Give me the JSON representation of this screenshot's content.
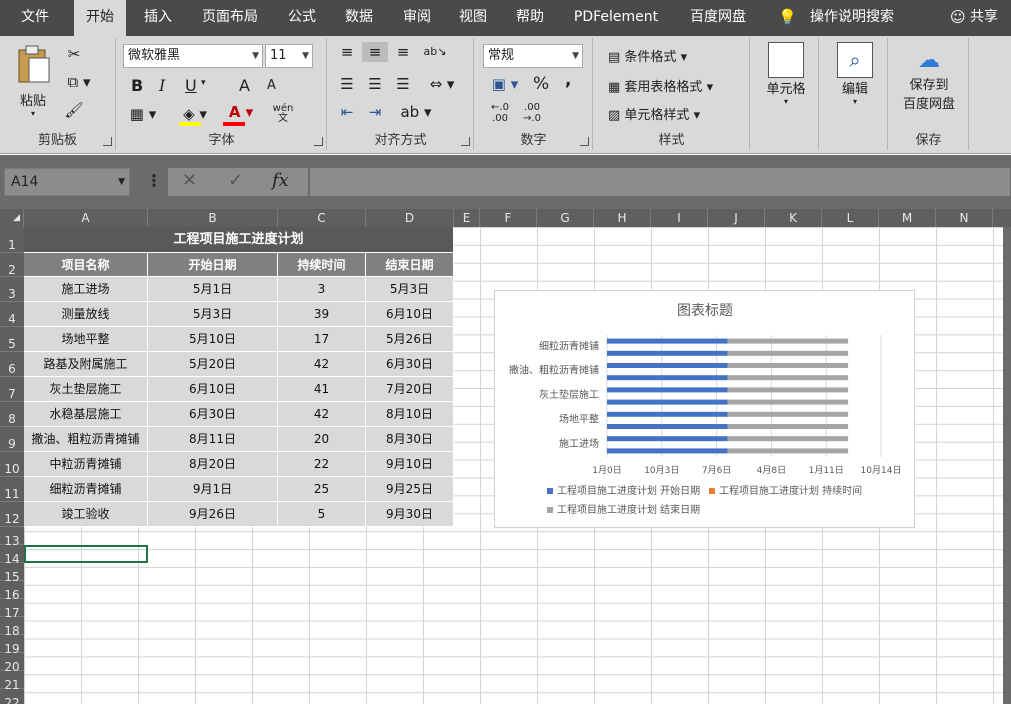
{
  "tabs": [
    "文件",
    "开始",
    "插入",
    "页面布局",
    "公式",
    "数据",
    "审阅",
    "视图",
    "帮助",
    "PDFelement",
    "百度网盘"
  ],
  "active_tab": "开始",
  "tell_me": "操作说明搜索",
  "share": "共享",
  "ribbon": {
    "clipboard": {
      "label": "剪贴板",
      "paste": "粘贴"
    },
    "font": {
      "label": "字体",
      "name": "微软雅黑",
      "size": "11",
      "bold": "B",
      "italic": "I",
      "underline": "U",
      "grow": "A",
      "shrink": "A",
      "wen": "wén 文"
    },
    "align": {
      "label": "对齐方式"
    },
    "number": {
      "label": "数字",
      "format": "常规",
      "percent": "%",
      "comma": ","
    },
    "styles": {
      "label": "样式",
      "cond": "条件格式",
      "table": "套用表格格式",
      "cell": "单元格样式"
    },
    "cells": {
      "label": "单元格"
    },
    "edit": {
      "label": "编辑"
    },
    "save": {
      "label": "保存",
      "btn1": "保存到",
      "btn2": "百度网盘"
    }
  },
  "formula_bar": {
    "name_box": "A14",
    "cancel": "✕",
    "enter": "✓",
    "fx": "fx",
    "formula": ""
  },
  "columns": [
    "A",
    "B",
    "C",
    "D",
    "E",
    "F",
    "G",
    "H",
    "I",
    "J",
    "K",
    "L",
    "M",
    "N"
  ],
  "rows": [
    "1",
    "2",
    "3",
    "4",
    "5",
    "6",
    "7",
    "8",
    "9",
    "10",
    "11",
    "12",
    "13",
    "14",
    "15",
    "16",
    "17",
    "18",
    "19",
    "20",
    "21",
    "22"
  ],
  "table": {
    "title": "工程项目施工进度计划",
    "headers": [
      "项目名称",
      "开始日期",
      "持续时间",
      "结束日期"
    ],
    "rows": [
      [
        "施工进场",
        "5月1日",
        "3",
        "5月3日"
      ],
      [
        "测量放线",
        "5月3日",
        "39",
        "6月10日"
      ],
      [
        "场地平整",
        "5月10日",
        "17",
        "5月26日"
      ],
      [
        "路基及附属施工",
        "5月20日",
        "42",
        "6月30日"
      ],
      [
        "灰土垫层施工",
        "6月10日",
        "41",
        "7月20日"
      ],
      [
        "水稳基层施工",
        "6月30日",
        "42",
        "8月10日"
      ],
      [
        "撒油、粗粒沥青摊铺",
        "8月11日",
        "20",
        "8月30日"
      ],
      [
        "中粒沥青摊铺",
        "8月20日",
        "22",
        "9月10日"
      ],
      [
        "细粒沥青摊铺",
        "9月1日",
        "25",
        "9月25日"
      ],
      [
        "竣工验收",
        "9月26日",
        "5",
        "9月30日"
      ]
    ]
  },
  "chart_data": {
    "type": "bar",
    "orientation": "horizontal",
    "stacked": true,
    "title": "图表标题",
    "categories": [
      "施工进场",
      "测量放线",
      "场地平整",
      "路基及附属施工",
      "灰土垫层施工",
      "水稳基层施工",
      "撒油、粗粒沥青摊铺",
      "中粒沥青摊铺",
      "细粒沥青摊铺",
      "竣工验收"
    ],
    "category_labels_shown": [
      "施工进场",
      "场地平整",
      "灰土垫层施工",
      "撒油、粗粒沥青摊铺",
      "细粒沥青摊铺"
    ],
    "x_ticks": [
      "1月0日",
      "10月3日",
      "7月6日",
      "4月8日",
      "1月11日",
      "10月14日"
    ],
    "x_range": [
      0,
      50000
    ],
    "series": [
      {
        "name": "工程项目施工进度计划 开始日期",
        "color": "#4472c4",
        "values": [
          22000,
          22000,
          22000,
          22000,
          22000,
          22000,
          22000,
          22000,
          22000,
          22000
        ]
      },
      {
        "name": "工程项目施工进度计划 持续时间",
        "color": "#ed7d31",
        "values": [
          0,
          0,
          0,
          0,
          0,
          0,
          0,
          0,
          0,
          0
        ]
      },
      {
        "name": "工程项目施工进度计划 结束日期",
        "color": "#a5a5a5",
        "values": [
          22000,
          22000,
          22000,
          22000,
          22000,
          22000,
          22000,
          22000,
          22000,
          22000
        ]
      }
    ],
    "legend_position": "bottom"
  }
}
